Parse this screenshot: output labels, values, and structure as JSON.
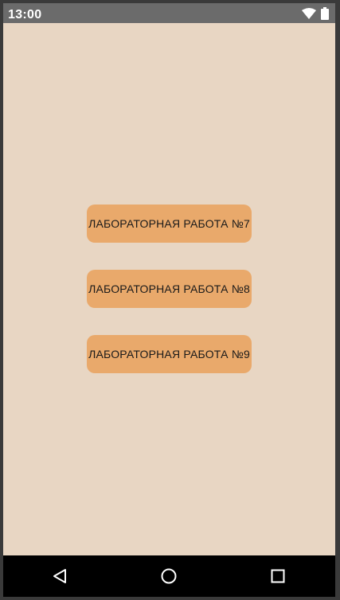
{
  "status_bar": {
    "time": "13:00",
    "icons": [
      "wifi-icon",
      "battery-icon"
    ]
  },
  "main": {
    "buttons": [
      {
        "label": "ЛАБОРАТОРНАЯ РАБОТА №7"
      },
      {
        "label": "ЛАБОРАТОРНАЯ РАБОТА №8"
      },
      {
        "label": "ЛАБОРАТОРНАЯ РАБОТА №9"
      }
    ]
  },
  "nav_bar": {
    "icons": [
      "back-icon",
      "home-icon",
      "recents-icon"
    ]
  },
  "colors": {
    "background": "#e8d6c3",
    "button": "#e9a96b",
    "status_bar": "#6b6b6b",
    "nav_bar": "#000000"
  }
}
